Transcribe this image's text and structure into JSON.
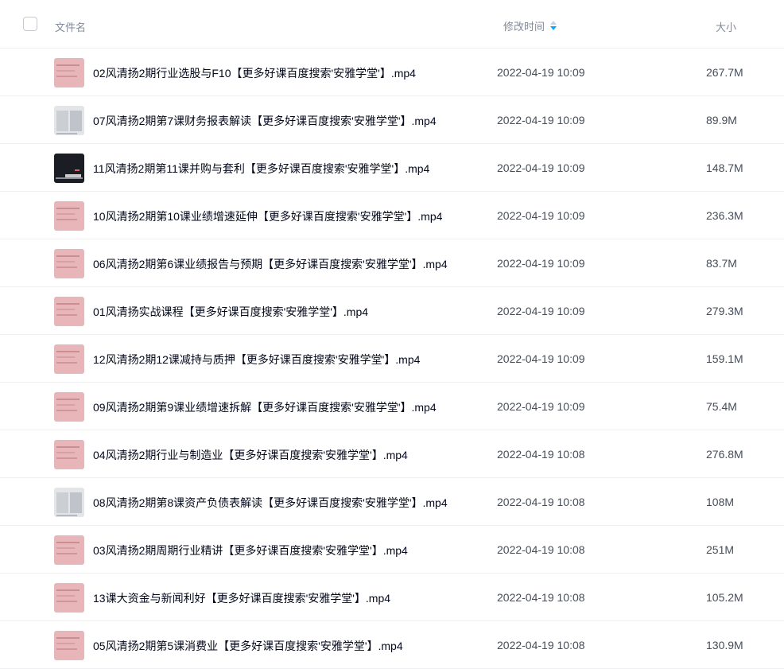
{
  "header": {
    "name_label": "文件名",
    "time_label": "修改时间",
    "size_label": "大小",
    "sort_icon": "sort-icon",
    "sort_active_color": "#06a7ff"
  },
  "files": [
    {
      "name": "02风清扬2期行业选股与F10【更多好课百度搜索'安雅学堂'】.mp4",
      "time": "2022-04-19 10:09",
      "size": "267.7M",
      "thumb": "pink"
    },
    {
      "name": "07风清扬2期第7课财务报表解读【更多好课百度搜索'安雅学堂'】.mp4",
      "time": "2022-04-19 10:09",
      "size": "89.9M",
      "thumb": "grey"
    },
    {
      "name": "11风清扬2期第11课并购与套利【更多好课百度搜索'安雅学堂'】.mp4",
      "time": "2022-04-19 10:09",
      "size": "148.7M",
      "thumb": "dark"
    },
    {
      "name": "10风清扬2期第10课业绩增速延伸【更多好课百度搜索'安雅学堂'】.mp4",
      "time": "2022-04-19 10:09",
      "size": "236.3M",
      "thumb": "pink"
    },
    {
      "name": "06风清扬2期第6课业绩报告与预期【更多好课百度搜索'安雅学堂'】.mp4",
      "time": "2022-04-19 10:09",
      "size": "83.7M",
      "thumb": "pink"
    },
    {
      "name": "01风清扬实战课程【更多好课百度搜索'安雅学堂'】.mp4",
      "time": "2022-04-19 10:09",
      "size": "279.3M",
      "thumb": "pink"
    },
    {
      "name": "12风清扬2期12课减持与质押【更多好课百度搜索'安雅学堂'】.mp4",
      "time": "2022-04-19 10:09",
      "size": "159.1M",
      "thumb": "pink"
    },
    {
      "name": "09风清扬2期第9课业绩增速拆解【更多好课百度搜索'安雅学堂'】.mp4",
      "time": "2022-04-19 10:09",
      "size": "75.4M",
      "thumb": "pink"
    },
    {
      "name": "04风清扬2期行业与制造业【更多好课百度搜索'安雅学堂'】.mp4",
      "time": "2022-04-19 10:08",
      "size": "276.8M",
      "thumb": "pink"
    },
    {
      "name": "08风清扬2期第8课资产负债表解读【更多好课百度搜索'安雅学堂'】.mp4",
      "time": "2022-04-19 10:08",
      "size": "108M",
      "thumb": "grey"
    },
    {
      "name": "03风清扬2期周期行业精讲【更多好课百度搜索'安雅学堂'】.mp4",
      "time": "2022-04-19 10:08",
      "size": "251M",
      "thumb": "pink"
    },
    {
      "name": "13课大资金与新闻利好【更多好课百度搜索'安雅学堂'】.mp4",
      "time": "2022-04-19 10:08",
      "size": "105.2M",
      "thumb": "pink"
    },
    {
      "name": "05风清扬2期第5课消费业【更多好课百度搜索'安雅学堂'】.mp4",
      "time": "2022-04-19 10:08",
      "size": "130.9M",
      "thumb": "pink"
    }
  ]
}
